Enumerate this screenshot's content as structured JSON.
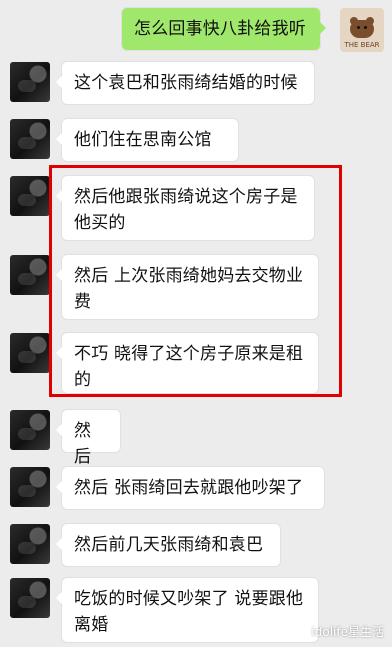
{
  "messages": [
    {
      "text": "怎么回事快八卦给我听"
    },
    {
      "text": "这个袁巴和张雨绮结婚的时候"
    },
    {
      "text": "他们住在思南公馆"
    },
    {
      "text": "然后他跟张雨绮说这个房子是他买的"
    },
    {
      "text": "然后 上次张雨绮她妈去交物业费"
    },
    {
      "text": "不巧 晓得了这个房子原来是租的"
    },
    {
      "text": "然后"
    },
    {
      "text": "然后 张雨绮回去就跟他吵架了"
    },
    {
      "text": "然后前几天张雨绮和袁巴"
    },
    {
      "text": "吃饭的时候又吵架了 说要跟他离婚"
    }
  ],
  "avatar_right_label": "THE BEAR",
  "watermark": {
    "text": "idolife星生活"
  },
  "colors": {
    "sent_bubble": "#9fe86b",
    "highlight_border": "#e10000"
  }
}
